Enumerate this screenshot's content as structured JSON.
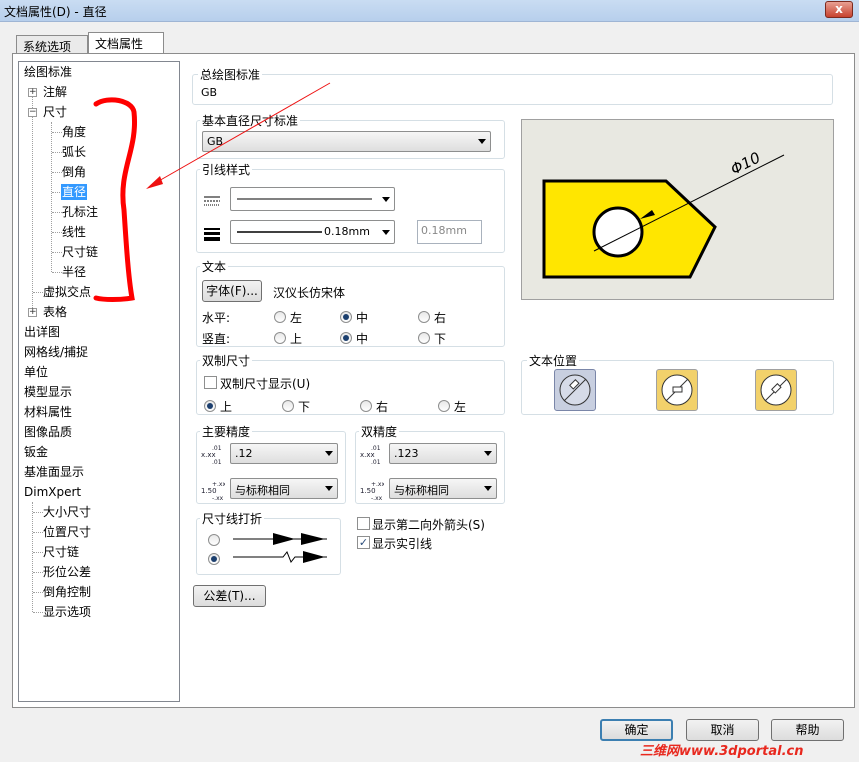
{
  "window": {
    "title": "文档属性(D) - 直径",
    "close_label": "x"
  },
  "tabs": [
    {
      "label": "系统选项(S)"
    },
    {
      "label": "文档属性(D)"
    }
  ],
  "tree": {
    "items": [
      {
        "label": "绘图标准"
      },
      {
        "label": "注解"
      },
      {
        "label": "尺寸"
      },
      {
        "label": "角度"
      },
      {
        "label": "弧长"
      },
      {
        "label": "倒角"
      },
      {
        "label": "直径"
      },
      {
        "label": "孔标注"
      },
      {
        "label": "线性"
      },
      {
        "label": "尺寸链"
      },
      {
        "label": "半径"
      },
      {
        "label": "虚拟交点"
      },
      {
        "label": "表格"
      },
      {
        "label": "出详图"
      },
      {
        "label": "网格线/捕捉"
      },
      {
        "label": "单位"
      },
      {
        "label": "模型显示"
      },
      {
        "label": "材料属性"
      },
      {
        "label": "图像品质"
      },
      {
        "label": "钣金"
      },
      {
        "label": "基准面显示"
      },
      {
        "label": "DimXpert"
      },
      {
        "label": "大小尺寸"
      },
      {
        "label": "位置尺寸"
      },
      {
        "label": "尺寸链"
      },
      {
        "label": "形位公差"
      },
      {
        "label": "倒角控制"
      },
      {
        "label": "显示选项"
      }
    ],
    "selected": "直径"
  },
  "overall_standard": {
    "title": "总绘图标准",
    "value": "GB"
  },
  "base_standard": {
    "title": "基本直径尺寸标准",
    "value": "GB"
  },
  "leader_style": {
    "title": "引线样式",
    "thickness_value": "0.18mm",
    "custom_thickness": "0.18mm"
  },
  "text": {
    "title": "文本",
    "font_button": "字体(F)...",
    "font_name": "汉仪长仿宋体",
    "horizontal_label": "水平:",
    "vertical_label": "竖直:",
    "h_options": [
      "左",
      "中",
      "右"
    ],
    "v_options": [
      "上",
      "中",
      "下"
    ],
    "h_selected": "中",
    "v_selected": "中"
  },
  "dual": {
    "title": "双制尺寸",
    "show_label": "双制尺寸显示(U)",
    "show_checked": false,
    "options": [
      "上",
      "下",
      "右",
      "左"
    ],
    "selected": "上"
  },
  "primary_precision": {
    "title": "主要精度",
    "value1": ".12",
    "value2": "与标称相同"
  },
  "dual_precision": {
    "title": "双精度",
    "value1": ".123",
    "value2": "与标称相同"
  },
  "dimension_break": {
    "title": "尺寸线打折",
    "selected_index": 1
  },
  "options": {
    "second_arrow_label": "显示第二向外箭头(S)",
    "second_arrow_checked": false,
    "solid_leader_label": "显示实引线",
    "solid_leader_checked": true
  },
  "tolerance_button": "公差(T)...",
  "preview": {
    "dim_label": "Φ10"
  },
  "text_position": {
    "title": "文本位置",
    "selected_index": 0
  },
  "footer": {
    "ok": "确定",
    "cancel": "取消",
    "help": "帮助"
  },
  "watermark": "三维网www.3dportal.cn",
  "colors": {
    "annotation_red": "#ff0000",
    "part_fill": "#ffe600",
    "selection": "#3399ff"
  }
}
